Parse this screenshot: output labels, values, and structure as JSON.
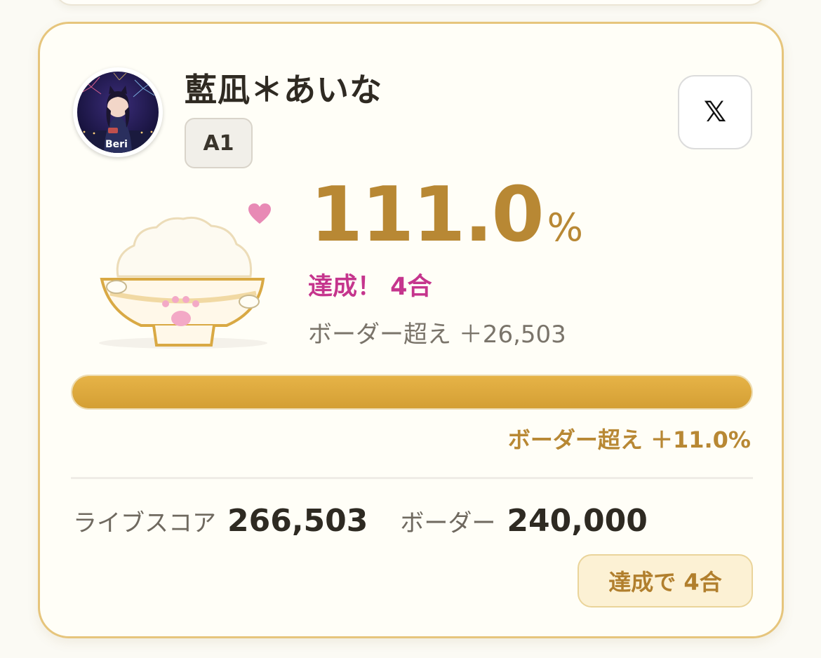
{
  "profile": {
    "name": "藍凪＊あいな",
    "rank": "A1",
    "avatar_text": "Beri"
  },
  "social": {
    "x_label": "𝕏"
  },
  "result": {
    "percent": "111.0",
    "percent_unit": "%",
    "achieved": "達成！ 4合",
    "over_border": "ボーダー超え ＋26,503"
  },
  "progress": {
    "fill_fraction": 1.0,
    "caption": "ボーダー超え ＋11.0%"
  },
  "stats": {
    "score_label": "ライブスコア",
    "score_value": "266,503",
    "border_label": "ボーダー",
    "border_value": "240,000"
  },
  "goal_badge": "達成で 4合",
  "colors": {
    "gold": "#b88834",
    "achieved_pink": "#c5358d",
    "progress": "#dca93c",
    "card_border": "#e6c57c"
  },
  "icons": [
    "x-logo-icon",
    "heart-icon",
    "rice-bowl-icon"
  ]
}
